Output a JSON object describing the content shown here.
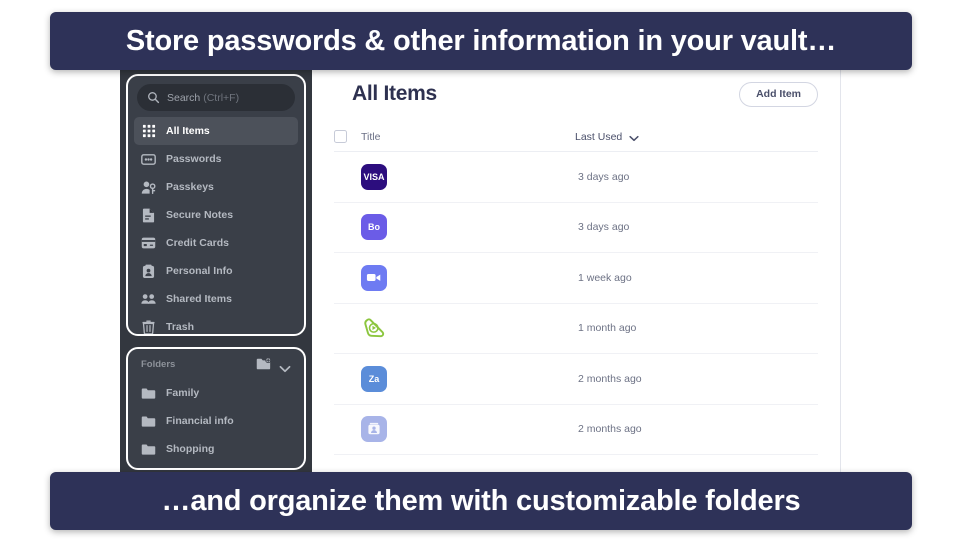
{
  "banners": {
    "top": "Store passwords & other information in your vault…",
    "bottom": "…and organize them with customizable folders",
    "color": "#2e3258"
  },
  "sidebar": {
    "search": {
      "label": "Search",
      "hint": "(Ctrl+F)",
      "icon": "search-icon"
    },
    "nav_items": [
      {
        "label": "All Items",
        "icon": "grid-icon",
        "active": true
      },
      {
        "label": "Passwords",
        "icon": "password-icon",
        "active": false
      },
      {
        "label": "Passkeys",
        "icon": "passkey-icon",
        "active": false
      },
      {
        "label": "Secure Notes",
        "icon": "note-icon",
        "active": false
      },
      {
        "label": "Credit Cards",
        "icon": "credit-card-icon",
        "active": false
      },
      {
        "label": "Personal Info",
        "icon": "person-id-icon",
        "active": false
      },
      {
        "label": "Shared Items",
        "icon": "people-icon",
        "active": false
      },
      {
        "label": "Trash",
        "icon": "trash-icon",
        "active": false
      }
    ],
    "folders_header": {
      "label": "Folders",
      "add_icon": "add-folder-icon",
      "collapse_icon": "chevron-down-icon"
    },
    "folders": [
      {
        "label": "Family",
        "icon": "folder-icon"
      },
      {
        "label": "Financial info",
        "icon": "folder-icon"
      },
      {
        "label": "Shopping",
        "icon": "folder-icon"
      }
    ]
  },
  "main": {
    "title": "All Items",
    "add_item_label": "Add Item",
    "columns": {
      "title": "Title",
      "sort": "Last Used",
      "sort_icon": "chevron-down-icon"
    },
    "rows": [
      {
        "icon": "visa-card-icon",
        "icon_label": "VISA",
        "icon_color": "#2c0d7e",
        "lines": 3,
        "last_used": "3 days ago"
      },
      {
        "icon": "box-app-icon",
        "icon_label": "Bo",
        "icon_color": "#6b5ce7",
        "lines": 2,
        "last_used": "3 days ago"
      },
      {
        "icon": "video-camera-icon",
        "icon_label": "",
        "icon_color": "#6e7bf2",
        "lines": 2,
        "last_used": "1 week ago"
      },
      {
        "icon": "green-play-icon",
        "icon_label": "",
        "icon_color": "#8cc63f",
        "lines": 2,
        "last_used": "1 month ago"
      },
      {
        "icon": "za-app-icon",
        "icon_label": "Za",
        "icon_color": "#5b8dd9",
        "lines": 3,
        "last_used": "2 months ago"
      },
      {
        "icon": "contact-card-icon",
        "icon_label": "",
        "icon_color": "#a8b4e8",
        "lines": 2,
        "last_used": "2 months ago"
      }
    ]
  }
}
